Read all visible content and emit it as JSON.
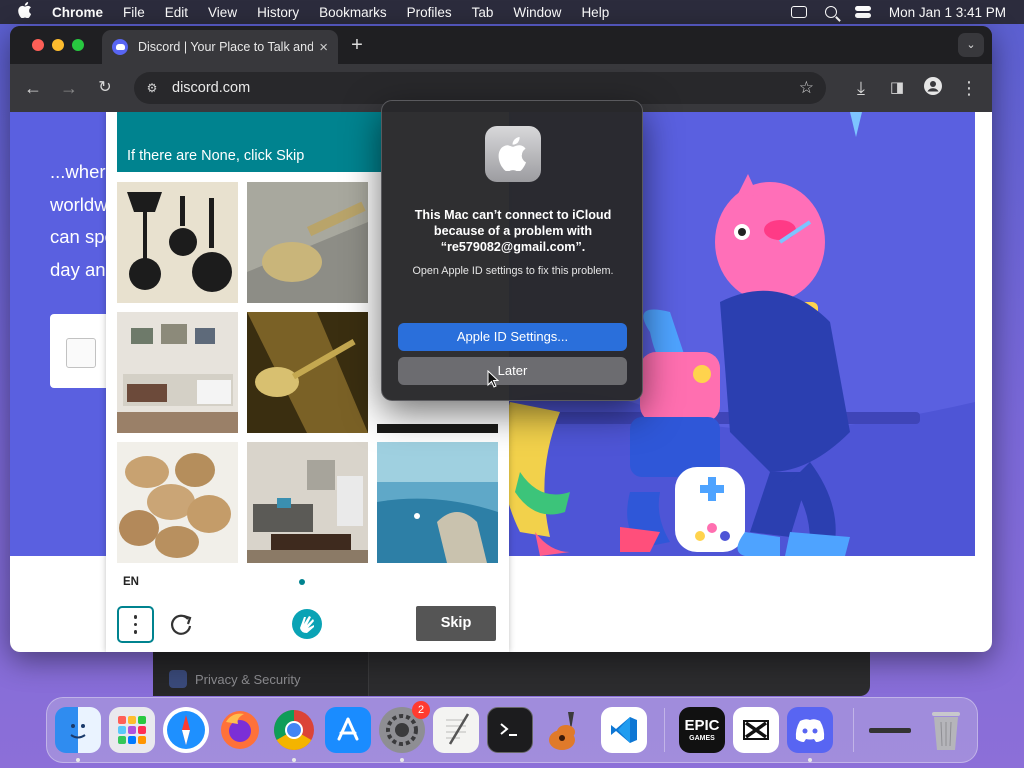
{
  "menubar": {
    "app_name": "Chrome",
    "items": [
      "File",
      "Edit",
      "View",
      "History",
      "Bookmarks",
      "Profiles",
      "Tab",
      "Window",
      "Help"
    ],
    "clock": "Mon Jan 1  3:41 PM"
  },
  "browser": {
    "tab_title": "Discord | Your Place to Talk and Hang Out",
    "new_tab": "+",
    "url": "discord.com"
  },
  "page": {
    "hero_lines": [
      "...wher",
      "worldw",
      "can spe",
      "day and"
    ],
    "captcha": {
      "instruction": "If there are None, click Skip",
      "language": "EN",
      "skip_label": "Skip",
      "tiles": [
        "kitchen-utensils",
        "spoon",
        "living-room-1",
        "brass-spoon",
        "dark-tile",
        "potatoes",
        "living-room-2",
        "seaside"
      ]
    }
  },
  "dialog": {
    "message": "This Mac can’t connect to iCloud because of a problem with “re579082@gmail.com”.",
    "info": "Open Apple ID settings to fix this problem.",
    "primary_button": "Apple ID Settings...",
    "secondary_button": "Later"
  },
  "background_window": {
    "sidebar_item": "Privacy & Security"
  },
  "dock": {
    "items": [
      "Finder",
      "Launchpad",
      "Safari",
      "Firefox",
      "Google Chrome",
      "App Store",
      "System Settings",
      "TextEdit",
      "Terminal",
      "GarageBand",
      "Visual Studio Code",
      "Epic Games Launcher",
      "CapCut",
      "Discord",
      "Downloads",
      "Trash"
    ],
    "settings_badge": "2",
    "epic_label_top": "EPIC",
    "epic_label_bottom": "GAMES"
  },
  "colors": {
    "discord_blurple": "#5865f2",
    "hero_bg": "#5a60e0",
    "captcha_teal": "#00838f",
    "dialog_primary": "#2a6fdb"
  }
}
